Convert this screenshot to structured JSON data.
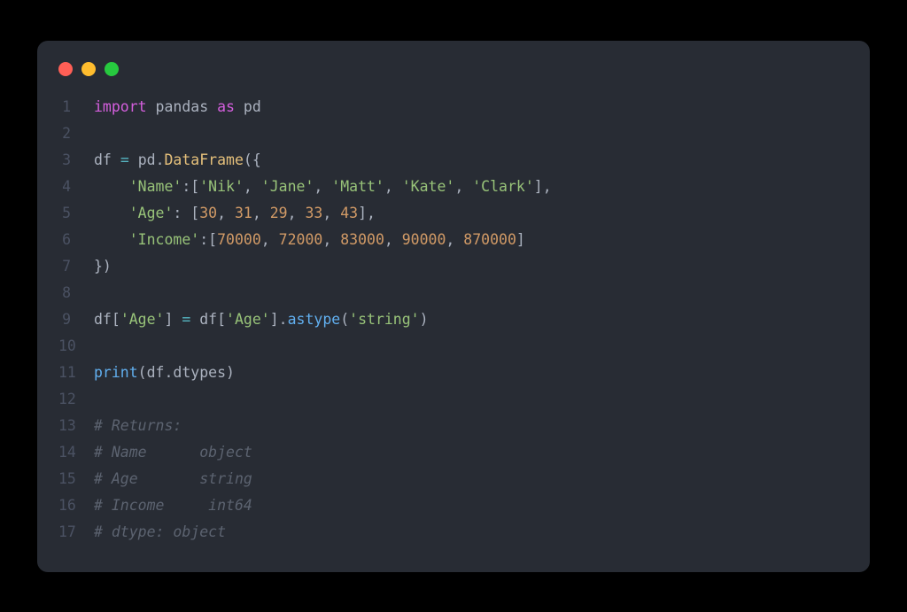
{
  "window": {
    "dots": [
      "red",
      "yellow",
      "green"
    ]
  },
  "lines": {
    "l1": {
      "num": "1",
      "import": "import",
      "pandas": "pandas",
      "as": "as",
      "pd": "pd"
    },
    "l2": {
      "num": "2"
    },
    "l3": {
      "num": "3",
      "df": "df",
      "eq": "=",
      "pd": "pd",
      "dot": ".",
      "DataFrame": "DataFrame",
      "open": "({"
    },
    "l4": {
      "num": "4",
      "indent": "    ",
      "key": "'Name'",
      "colon": ":[",
      "v1": "'Nik'",
      "c1": ", ",
      "v2": "'Jane'",
      "c2": ", ",
      "v3": "'Matt'",
      "c3": ", ",
      "v4": "'Kate'",
      "c4": ", ",
      "v5": "'Clark'",
      "end": "],"
    },
    "l5": {
      "num": "5",
      "indent": "    ",
      "key": "'Age'",
      "colon": ": [",
      "v1": "30",
      "c1": ", ",
      "v2": "31",
      "c2": ", ",
      "v3": "29",
      "c3": ", ",
      "v4": "33",
      "c4": ", ",
      "v5": "43",
      "end": "],"
    },
    "l6": {
      "num": "6",
      "indent": "    ",
      "key": "'Income'",
      "colon": ":[",
      "v1": "70000",
      "c1": ", ",
      "v2": "72000",
      "c2": ", ",
      "v3": "83000",
      "c3": ", ",
      "v4": "90000",
      "c4": ", ",
      "v5": "870000",
      "end": "]"
    },
    "l7": {
      "num": "7",
      "close": "})"
    },
    "l8": {
      "num": "8"
    },
    "l9": {
      "num": "9",
      "df1": "df[",
      "age1": "'Age'",
      "b1": "] ",
      "eq": "=",
      "sp": " ",
      "df2": "df[",
      "age2": "'Age'",
      "b2": "].",
      "astype": "astype",
      "p1": "(",
      "s": "'string'",
      "p2": ")"
    },
    "l10": {
      "num": "10"
    },
    "l11": {
      "num": "11",
      "print": "print",
      "p1": "(",
      "df": "df",
      "dot": ".",
      "dtypes": "dtypes",
      "p2": ")"
    },
    "l12": {
      "num": "12"
    },
    "l13": {
      "num": "13",
      "c": "# Returns:"
    },
    "l14": {
      "num": "14",
      "c": "# Name      object"
    },
    "l15": {
      "num": "15",
      "c": "# Age       string"
    },
    "l16": {
      "num": "16",
      "c": "# Income     int64"
    },
    "l17": {
      "num": "17",
      "c": "# dtype: object"
    }
  }
}
